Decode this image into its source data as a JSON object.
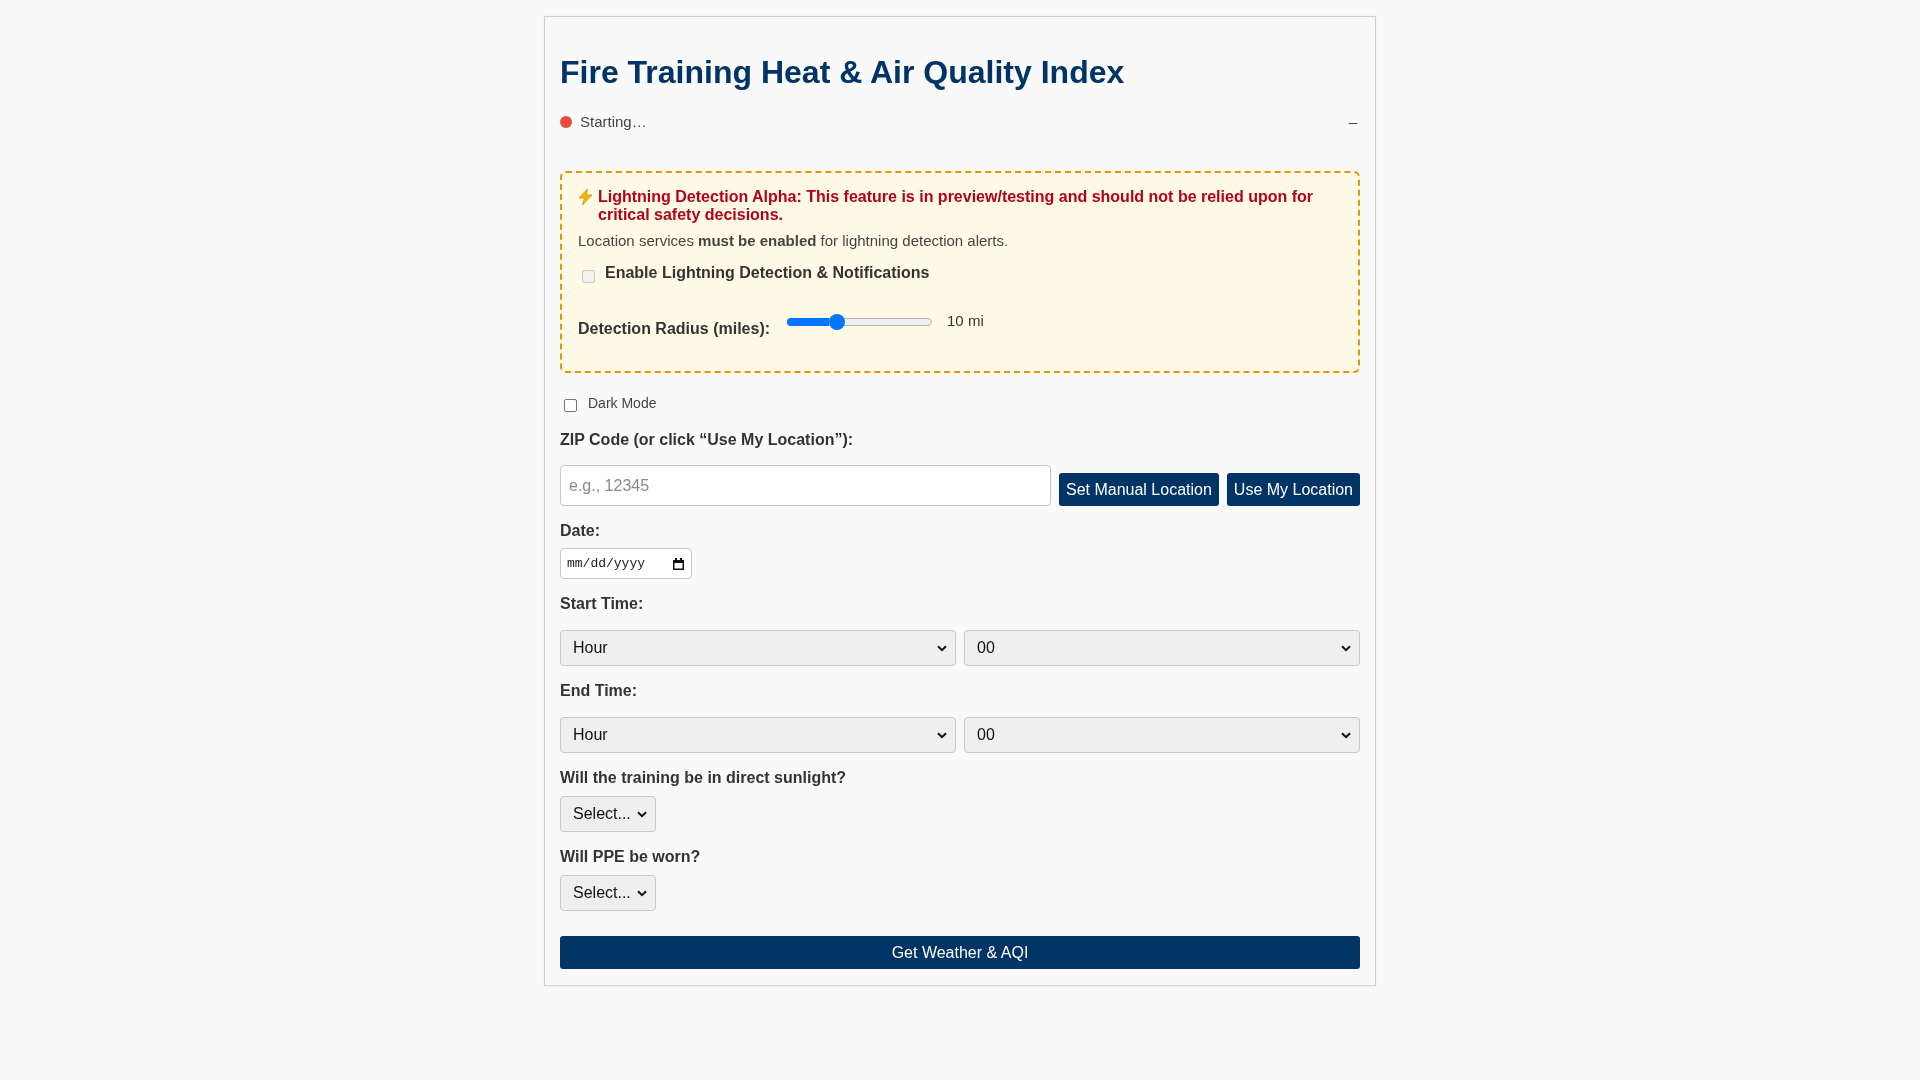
{
  "title": "Fire Training Heat & Air Quality Index",
  "status": {
    "text": "Starting…",
    "color": "#e74c3c",
    "toggle": "–"
  },
  "lightning": {
    "warning": "Lightning Detection Alpha: This feature is in preview/testing and should not be relied upon for critical safety decisions.",
    "note": "Location services **must be enabled** for lightning detection alerts.",
    "enable": {
      "label": "Enable Lightning Detection & Notifications",
      "checked": false,
      "disabled": true
    },
    "radius": {
      "label": "Detection Radius (miles):",
      "level": 0.33,
      "reading": "10 mi"
    }
  },
  "dark_mode": {
    "label": "Dark Mode",
    "checked": false
  },
  "zip": {
    "label": "ZIP Code (or click “Use My Location”):",
    "placeholder": "e.g., 12345",
    "buttons": [
      "Set Manual Location",
      "Use My Location"
    ]
  },
  "date": {
    "label": "Date:",
    "placeholder": "mm/dd/yyyy"
  },
  "start_time": {
    "label": "Start Time:",
    "hour": "Hour",
    "minute": "00"
  },
  "end_time": {
    "label": "End Time:",
    "hour": "Hour",
    "minute": "00"
  },
  "questions": [
    {
      "label": "Will the training be in direct sunlight?",
      "value": "Select..."
    },
    {
      "label": "Will PPE be worn?",
      "value": "Select..."
    }
  ],
  "submit": "Get Weather & AQI"
}
